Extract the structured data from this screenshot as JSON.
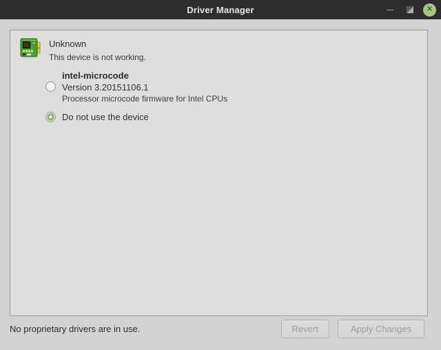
{
  "colors": {
    "titlebar-bg": "#2e2e2e",
    "window-bg": "#d3d3d2",
    "panel-bg": "#dededd",
    "accent-green": "#94b46a",
    "close-button-green": "#a4c883"
  },
  "window": {
    "title": "Driver Manager",
    "controls": {
      "minimize_icon": "minimize-icon",
      "restore_icon": "restore-icon",
      "close_icon": "close-icon",
      "close_glyph": "✕"
    }
  },
  "device": {
    "icon": "circuit-board-icon",
    "name": "Unknown",
    "status": "This device is not working."
  },
  "driver_options": [
    {
      "name": "intel-microcode",
      "version": "Version 3.20151106.1",
      "description": "Processor microcode firmware for Intel CPUs",
      "selected": false
    },
    {
      "name": "Do not use the device",
      "selected": true
    }
  ],
  "footer": {
    "status_text": "No proprietary drivers are in use.",
    "revert_label": "Revert",
    "apply_label": "Apply Changes",
    "buttons_enabled": false
  }
}
